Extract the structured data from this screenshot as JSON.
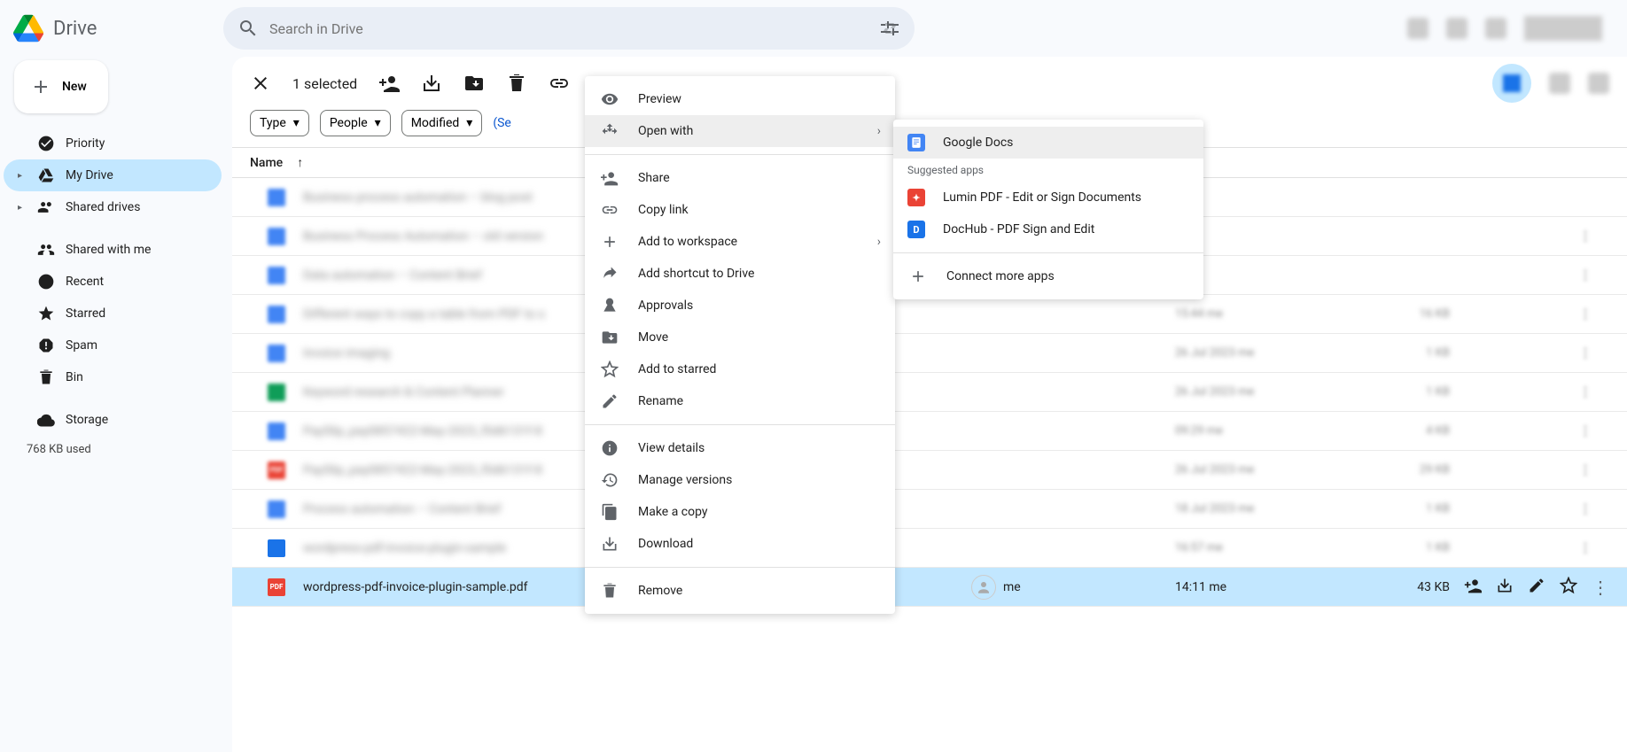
{
  "header": {
    "app_name": "Drive",
    "search_placeholder": "Search in Drive"
  },
  "sidebar": {
    "new_label": "New",
    "items": [
      {
        "label": "Priority"
      },
      {
        "label": "My Drive"
      },
      {
        "label": "Shared drives"
      },
      {
        "label": "Shared with me"
      },
      {
        "label": "Recent"
      },
      {
        "label": "Starred"
      },
      {
        "label": "Spam"
      },
      {
        "label": "Bin"
      },
      {
        "label": "Storage"
      }
    ],
    "storage_used": "768 KB used"
  },
  "toolbar": {
    "selection": "1 selected"
  },
  "filters": {
    "type": "Type",
    "people": "People",
    "modified": "Modified",
    "search_link": "(Se"
  },
  "columns": {
    "name": "Name"
  },
  "rows": [
    {
      "name_blur": "Business process automation – blog post",
      "type": "doc"
    },
    {
      "name_blur": "Business Process Automation – old version",
      "type": "doc"
    },
    {
      "name_blur": "Data automation – Content Brief",
      "type": "doc"
    },
    {
      "name_blur": "Different ways to copy a table from PDF to s",
      "type": "doc",
      "mod": "15:44 me",
      "size": "16 KB"
    },
    {
      "name_blur": "Invoice imaging",
      "type": "doc",
      "mod": "26 Jul 2023 me",
      "size": "1 KB"
    },
    {
      "name_blur": "Keyword research & Content Planner",
      "type": "sheet",
      "mod": "26 Jul 2023 me",
      "size": "1 KB"
    },
    {
      "name_blur": "PaySlip_pay0857422-May-2023_f0d6131f-8",
      "type": "doc",
      "mod": "09:29 me",
      "size": "4 KB"
    },
    {
      "name_blur": "PaySlip_pay0857422-May-2023_f0d6131f-8",
      "type": "pdf",
      "mod": "26 Jul 2023 me",
      "size": "29 KB"
    },
    {
      "name_blur": "Process automation – Content Brief",
      "type": "doc",
      "mod": "18 Jul 2023 me",
      "size": "1 KB"
    },
    {
      "name_blur": "wordpress-pdf-invoice-plugin-sample",
      "type": "docx",
      "mod": "16:57 me",
      "size": "1 KB"
    }
  ],
  "selected_row": {
    "name": "wordpress-pdf-invoice-plugin-sample.pdf",
    "owner": "me",
    "modified": "14:11 me",
    "size": "43 KB"
  },
  "context_menu": {
    "items": [
      {
        "label": "Preview",
        "icon": "eye"
      },
      {
        "label": "Open with",
        "icon": "open",
        "submenu": true,
        "hover": true
      },
      {
        "divider": true
      },
      {
        "label": "Share",
        "icon": "share"
      },
      {
        "label": "Copy link",
        "icon": "link"
      },
      {
        "label": "Add to workspace",
        "icon": "plus",
        "submenu": true
      },
      {
        "label": "Add shortcut to Drive",
        "icon": "shortcut"
      },
      {
        "label": "Approvals",
        "icon": "approval"
      },
      {
        "label": "Move",
        "icon": "move"
      },
      {
        "label": "Add to starred",
        "icon": "star"
      },
      {
        "label": "Rename",
        "icon": "rename"
      },
      {
        "divider": true
      },
      {
        "label": "View details",
        "icon": "info"
      },
      {
        "label": "Manage versions",
        "icon": "history"
      },
      {
        "label": "Make a copy",
        "icon": "copy"
      },
      {
        "label": "Download",
        "icon": "download"
      },
      {
        "divider": true
      },
      {
        "label": "Remove",
        "icon": "trash"
      }
    ]
  },
  "submenu": {
    "google_docs": "Google Docs",
    "suggested_header": "Suggested apps",
    "apps": [
      {
        "label": "Lumin PDF - Edit or Sign Documents",
        "color": "#ea4335"
      },
      {
        "label": "DocHub - PDF Sign and Edit",
        "color": "#1a73e8"
      }
    ],
    "connect": "Connect more apps"
  }
}
